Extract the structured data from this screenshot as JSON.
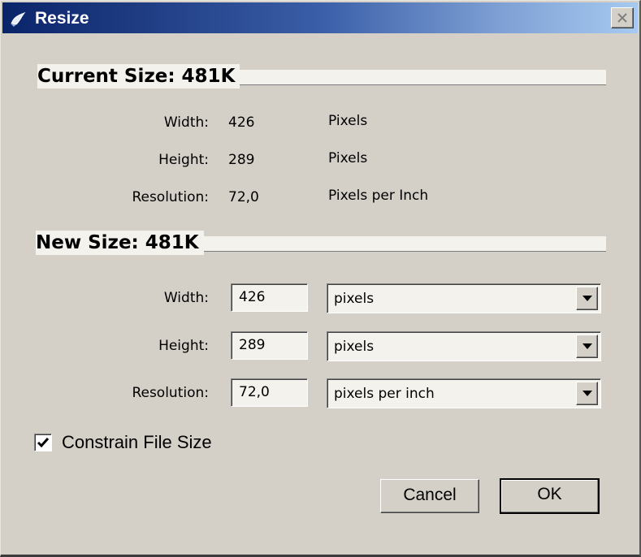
{
  "window": {
    "title": "Resize",
    "title_icon": "app-icon",
    "close_icon": "close-icon"
  },
  "current_size": {
    "heading": "Current Size: 481K",
    "width_label": "Width:",
    "width": "426",
    "width_unit": "Pixels",
    "height_label": "Height:",
    "height": "289",
    "height_unit": "Pixels",
    "resolution_label": "Resolution:",
    "resolution": "72,0",
    "resolution_unit": "Pixels per Inch"
  },
  "new_size": {
    "heading": "New Size: 481K",
    "width": {
      "label": "Width:",
      "value": "426",
      "unit": "pixels"
    },
    "height": {
      "label": "Height:",
      "value": "289",
      "unit": "pixels"
    },
    "resolution": {
      "label": "Resolution:",
      "value": "72,0",
      "unit": "pixels per inch"
    },
    "dropdown_icon": "chevron-down-icon"
  },
  "constrain": {
    "label": "Constrain File Size",
    "checked": true
  },
  "buttons": {
    "cancel": "Cancel",
    "ok": "OK"
  },
  "colors": {
    "title_gradient_start": "#0a246a",
    "title_gradient_end": "#a6caf0",
    "dialog_bg": "#d4d0c8"
  }
}
